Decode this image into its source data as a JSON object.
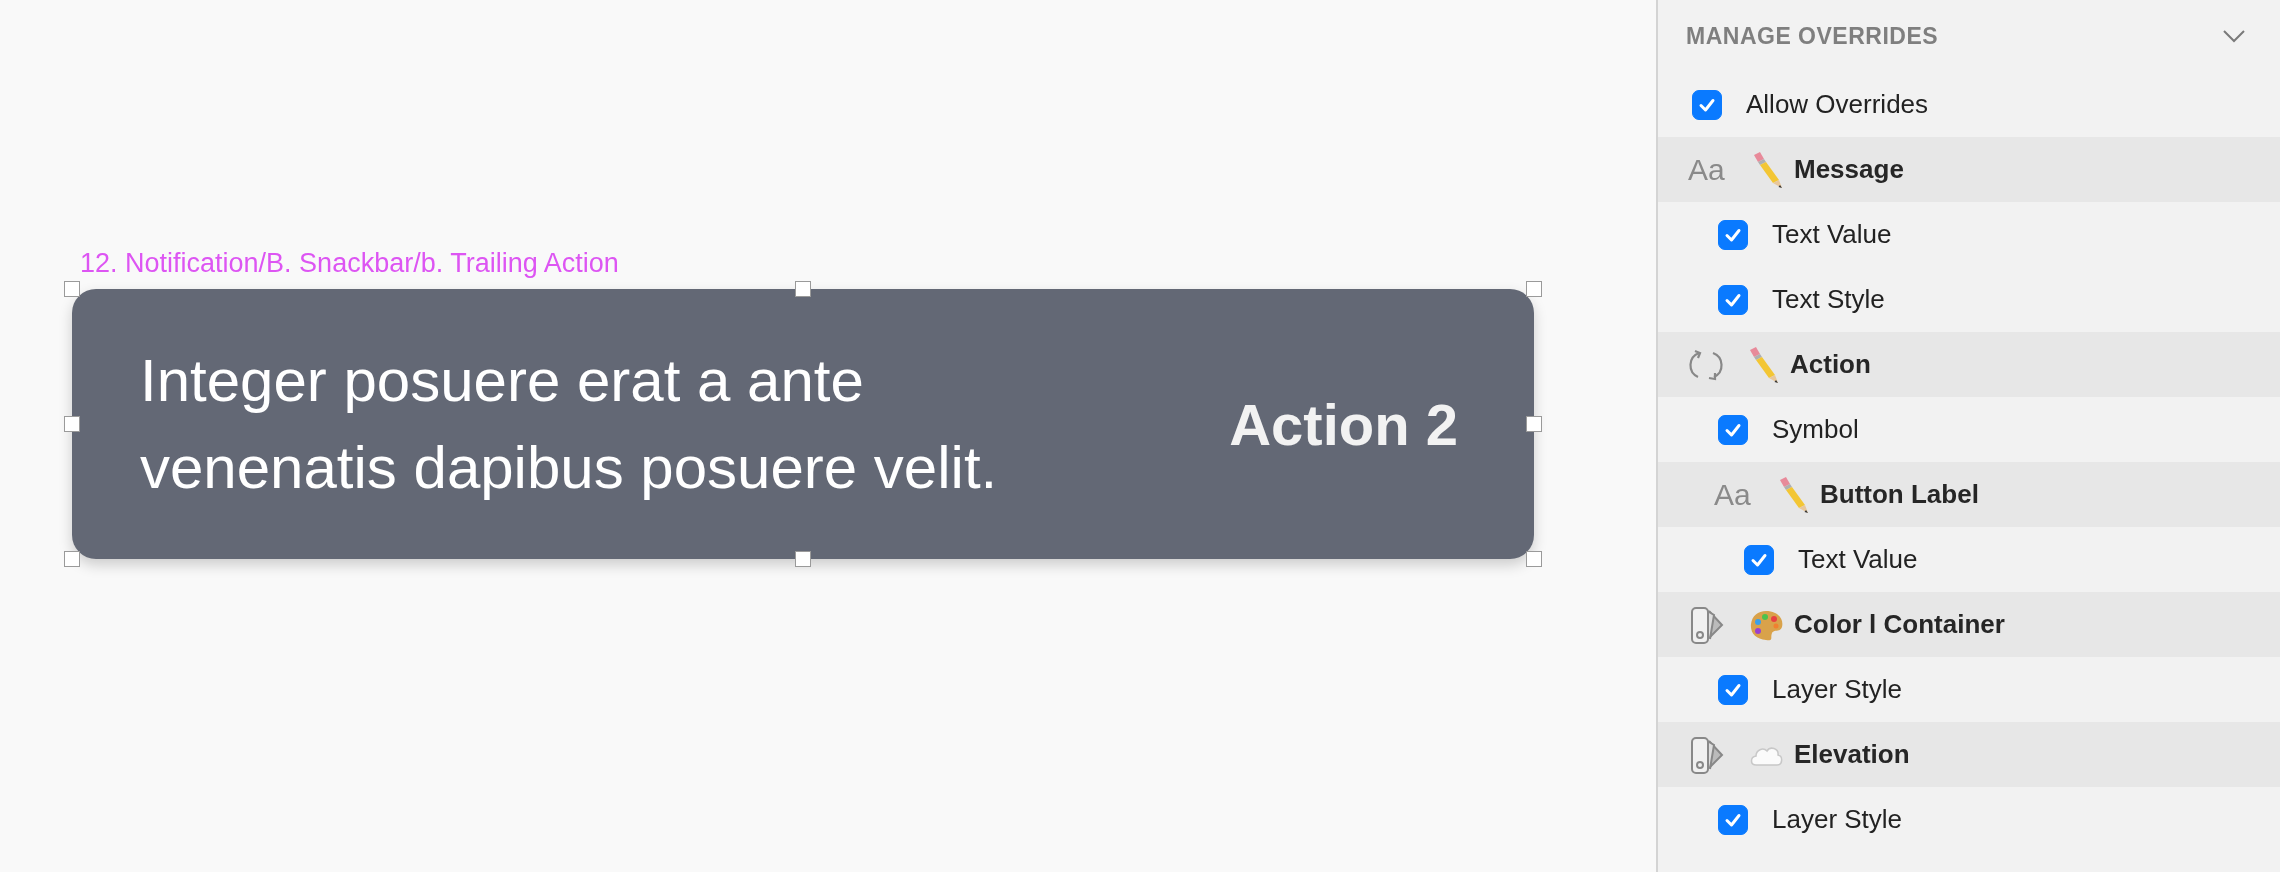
{
  "canvas": {
    "layer_path": "12. Notification/B. Snackbar/b. Trailing Action",
    "snackbar": {
      "message": "Integer posuere erat a ante venenatis dapibus posuere velit.",
      "action": "Action 2",
      "selected": true
    }
  },
  "panel": {
    "title": "MANAGE OVERRIDES",
    "expanded": true,
    "allow_overrides": {
      "label": "Allow Overrides",
      "checked": true
    },
    "overrides": [
      {
        "kind": "text_edit",
        "glyph": "Aa",
        "label": "Message",
        "children": [
          {
            "label": "Text Value",
            "checked": true
          },
          {
            "label": "Text Style",
            "checked": true
          }
        ]
      },
      {
        "kind": "symbol_edit",
        "label": "Action",
        "children": [
          {
            "label": "Symbol",
            "checked": true
          },
          {
            "kind": "text_edit",
            "glyph": "Aa",
            "label": "Button Label",
            "children": [
              {
                "label": "Text Value",
                "checked": true
              }
            ]
          }
        ]
      },
      {
        "kind": "style_color",
        "label": "Color l Container",
        "children": [
          {
            "label": "Layer Style",
            "checked": true
          }
        ]
      },
      {
        "kind": "style_shadow",
        "label": "Elevation",
        "children": [
          {
            "label": "Layer Style",
            "checked": true
          }
        ]
      }
    ]
  }
}
